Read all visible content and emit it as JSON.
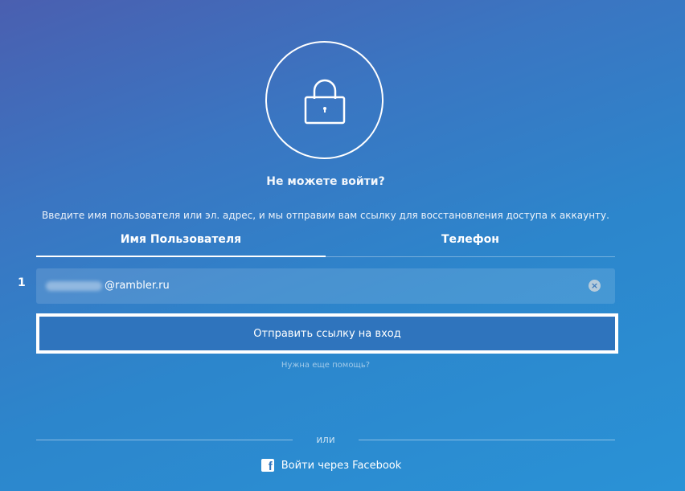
{
  "header": {
    "lock_icon": "lock-icon",
    "title": "Не можете войти?",
    "description": "Введите имя пользователя или эл. адрес, и мы отправим вам ссылку для восстановления доступа к аккаунту."
  },
  "tabs": [
    {
      "label": "Имя Пользователя",
      "active": true
    },
    {
      "label": "Телефон",
      "active": false
    }
  ],
  "form": {
    "step_marker": "1",
    "input_value_visible": "@rambler.ru",
    "clear_icon": "clear-icon",
    "submit_label": "Отправить ссылку на вход",
    "help_link": "Нужна еще помощь?"
  },
  "footer": {
    "or_label": "или",
    "facebook_icon": "facebook-icon",
    "facebook_label": "Войти через Facebook"
  },
  "colors": {
    "gradient_top": "#4a5fb0",
    "gradient_bottom": "#2a92d6",
    "button_bg": "#2f74bd",
    "text": "#ffffff"
  }
}
